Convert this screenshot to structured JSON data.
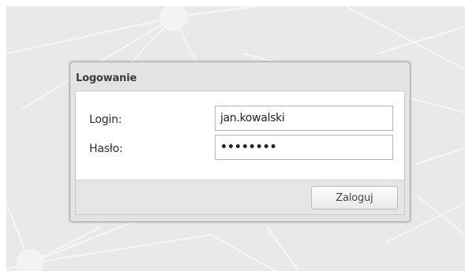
{
  "login_box": {
    "title": "Logowanie",
    "login_label": "Login:",
    "login_value": "jan.kowalski",
    "password_label": "Hasło:",
    "password_value": "••••••••",
    "submit_label": "Zaloguj"
  },
  "colors": {
    "background": "#e9e9e9",
    "panel_bg": "#e3e3e3",
    "panel_border": "#a9a9a9",
    "form_bg": "#ffffff",
    "text": "#2b2b2b"
  }
}
